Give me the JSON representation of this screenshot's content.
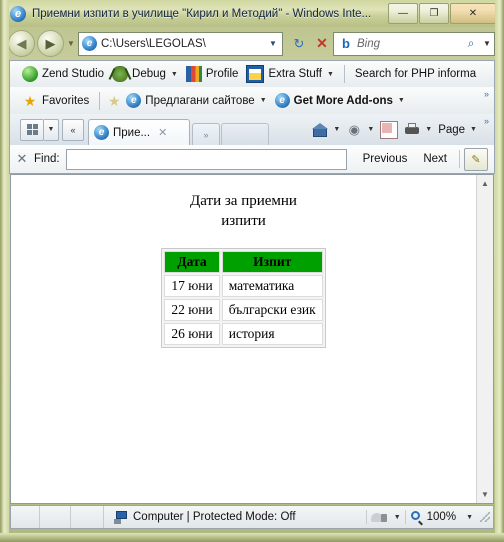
{
  "window": {
    "title": "Приемни изпити в училище \"Кирил и Методий\" - Windows Inte...",
    "app_icon": "internet-explorer-icon",
    "minimize_label": "—",
    "maximize_label": "❐",
    "close_label": "✕"
  },
  "nav": {
    "back_label": "◀",
    "forward_label": "▶",
    "recent_label": "▼",
    "address_value": "C:\\Users\\LEGOLAS\\",
    "address_dropdown_label": "▼",
    "refresh_label": "↻",
    "stop_label": "✕",
    "search_placeholder": "Bing",
    "search_icon": "magnifier-icon",
    "search_dropdown_label": "▼"
  },
  "zend_toolbar": {
    "items": [
      {
        "label": "Zend Studio",
        "icon": "zend-icon",
        "caret": ""
      },
      {
        "label": "Debug",
        "icon": "bug-icon",
        "caret": "▼"
      },
      {
        "label": "Profile",
        "icon": "profile-icon",
        "caret": ""
      },
      {
        "label": "Extra Stuff",
        "icon": "extra-stuff-icon",
        "caret": "▼"
      }
    ],
    "search_label": "Search for PHP informa"
  },
  "favorites_bar": {
    "favorites_label": "Favorites",
    "items": [
      {
        "label": "Предлагани сайтове",
        "icon": "internet-explorer-icon",
        "caret": "▼"
      },
      {
        "label": "Get More Add-ons",
        "icon": "internet-explorer-icon",
        "caret": "▼"
      }
    ],
    "overflow_label": "»"
  },
  "tabbar": {
    "quick_tabs_label": "▼",
    "tab_list_label": "«",
    "tabs": [
      {
        "title": "Прие...",
        "close_label": "✕",
        "icon": "internet-explorer-icon"
      }
    ],
    "new_tab_label": "»",
    "overflow_label": "»",
    "commands": [
      {
        "label": "",
        "icon": "home-icon",
        "caret": "▼"
      },
      {
        "label": "",
        "icon": "rss-icon",
        "caret": "▼"
      },
      {
        "label": "",
        "icon": "mail-icon",
        "caret": ""
      },
      {
        "label": "",
        "icon": "print-icon",
        "caret": "▼"
      },
      {
        "label": "Page",
        "icon": "",
        "caret": "▼"
      }
    ]
  },
  "findbar": {
    "close_label": "✕",
    "label": "Find:",
    "input_value": "",
    "previous_label": "Previous",
    "next_label": "Next",
    "highlight_icon": "highlighter-icon"
  },
  "page": {
    "title_line1": "Дати за приемни",
    "title_line2": "изпити",
    "table": {
      "headers": [
        "Дата",
        "Изпит"
      ],
      "rows": [
        [
          "17 юни",
          "математика"
        ],
        [
          "22 юни",
          "български език"
        ],
        [
          "26 юни",
          "история"
        ]
      ],
      "header_bg": "#00a000"
    },
    "scroll_up_label": "▲",
    "scroll_down_label": "▼"
  },
  "statusbar": {
    "zone_text": "Computer | Protected Mode: Off",
    "zone_icon": "computer-icon",
    "security_icon": "lock-icon",
    "security_caret": "▼",
    "zoom_icon": "zoom-icon",
    "zoom_value": "100%",
    "zoom_caret": "▼"
  }
}
